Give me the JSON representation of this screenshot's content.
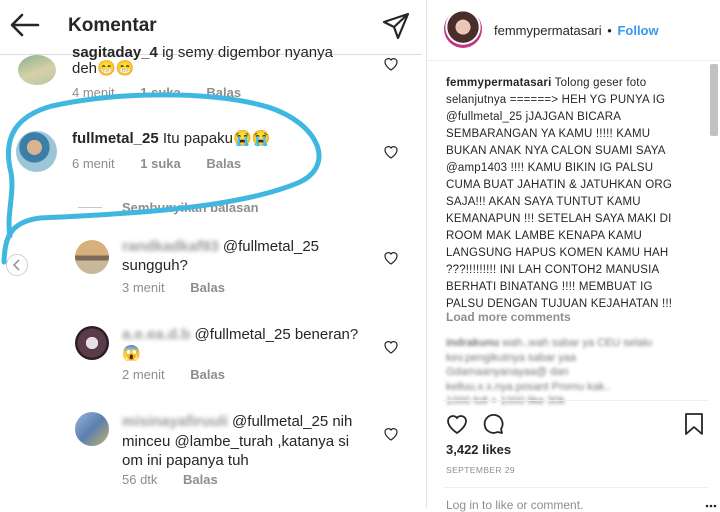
{
  "left": {
    "title": "Komentar",
    "comments": [
      {
        "user": "sagitaday_4",
        "text": "ig semy digembor nyanya",
        "text2": "deh😁😁",
        "time": "4 menit",
        "likes": "1 suka",
        "reply": "Balas"
      },
      {
        "user": "fullmetal_25",
        "text": "Itu papaku😭😭",
        "time": "6 menit",
        "likes": "1 suka",
        "reply": "Balas"
      }
    ],
    "hide_replies": "Sembunyikan balasan",
    "replies": [
      {
        "user": "randkadkaf93",
        "mention": "@fullmetal_25",
        "text": "sungguh?",
        "time": "3 menit",
        "reply": "Balas"
      },
      {
        "user": "a.e.ea.d.b",
        "mention": "@fullmetal_25",
        "text": "beneran?",
        "text2": "😱",
        "time": "2 menit",
        "reply": "Balas"
      },
      {
        "user": "misinayafiruuli",
        "mention": "@fullmetal_25",
        "text": "nih",
        "line2a": "minceu",
        "mention2": "@lambe_turah",
        "line2b": ",katanya si",
        "line3": "om ini papanya tuh",
        "time": "56 dtk",
        "reply": "Balas"
      }
    ]
  },
  "right": {
    "username": "femmypermatasari",
    "dot": "•",
    "follow": "Follow",
    "caption": {
      "user": "femmypermatasari",
      "lines": [
        " Tolong geser foto",
        "selanjutnya ======> HEH YG PUNYA IG",
        "@fullmetal_25 jJAJGAN BICARA",
        "SEMBARANGAN YA KAMU !!!!! KAMU",
        "BUKAN ANAK NYA CALON SUAMI SAYA",
        "@amp1403 !!!! KAMU BIKIN IG PALSU",
        "CUMA BUAT JAHATIN & JATUHKAN ORG",
        "SAJA!!! AKAN SAYA TUNTUT KAMU",
        "KEMANAPUN !!! SETELAH SAYA MAKI DI",
        "ROOM MAK LAMBE KENAPA KAMU",
        "LANGSUNG HAPUS KOMEN KAMU HAH",
        "???!!!!!!!!! INI LAH CONTOH2 MANUSIA",
        "BERHATI BINATANG !!!! MEMBUAT IG",
        "PALSU DENGAN TUJUAN KEJAHATAN !!!"
      ]
    },
    "load_more": "Load more comments",
    "blurred": [
      {
        "user": "indrakunu",
        "text": "wah..wah sabar ya CEU selalu"
      },
      {
        "user": "",
        "text": "kev.pengikutnya sabar yaa"
      },
      {
        "user": "",
        "text": "Gdamaanyanayaa@ dan"
      },
      {
        "user": "",
        "text": "kelluu.x.x.nya.posant Promu kak.."
      },
      {
        "user": "",
        "text": "1000 foll + 1000 like 30k"
      }
    ],
    "likes": "3,422 likes",
    "date": "SEPTEMBER 29",
    "login": "Log in to like or comment."
  }
}
